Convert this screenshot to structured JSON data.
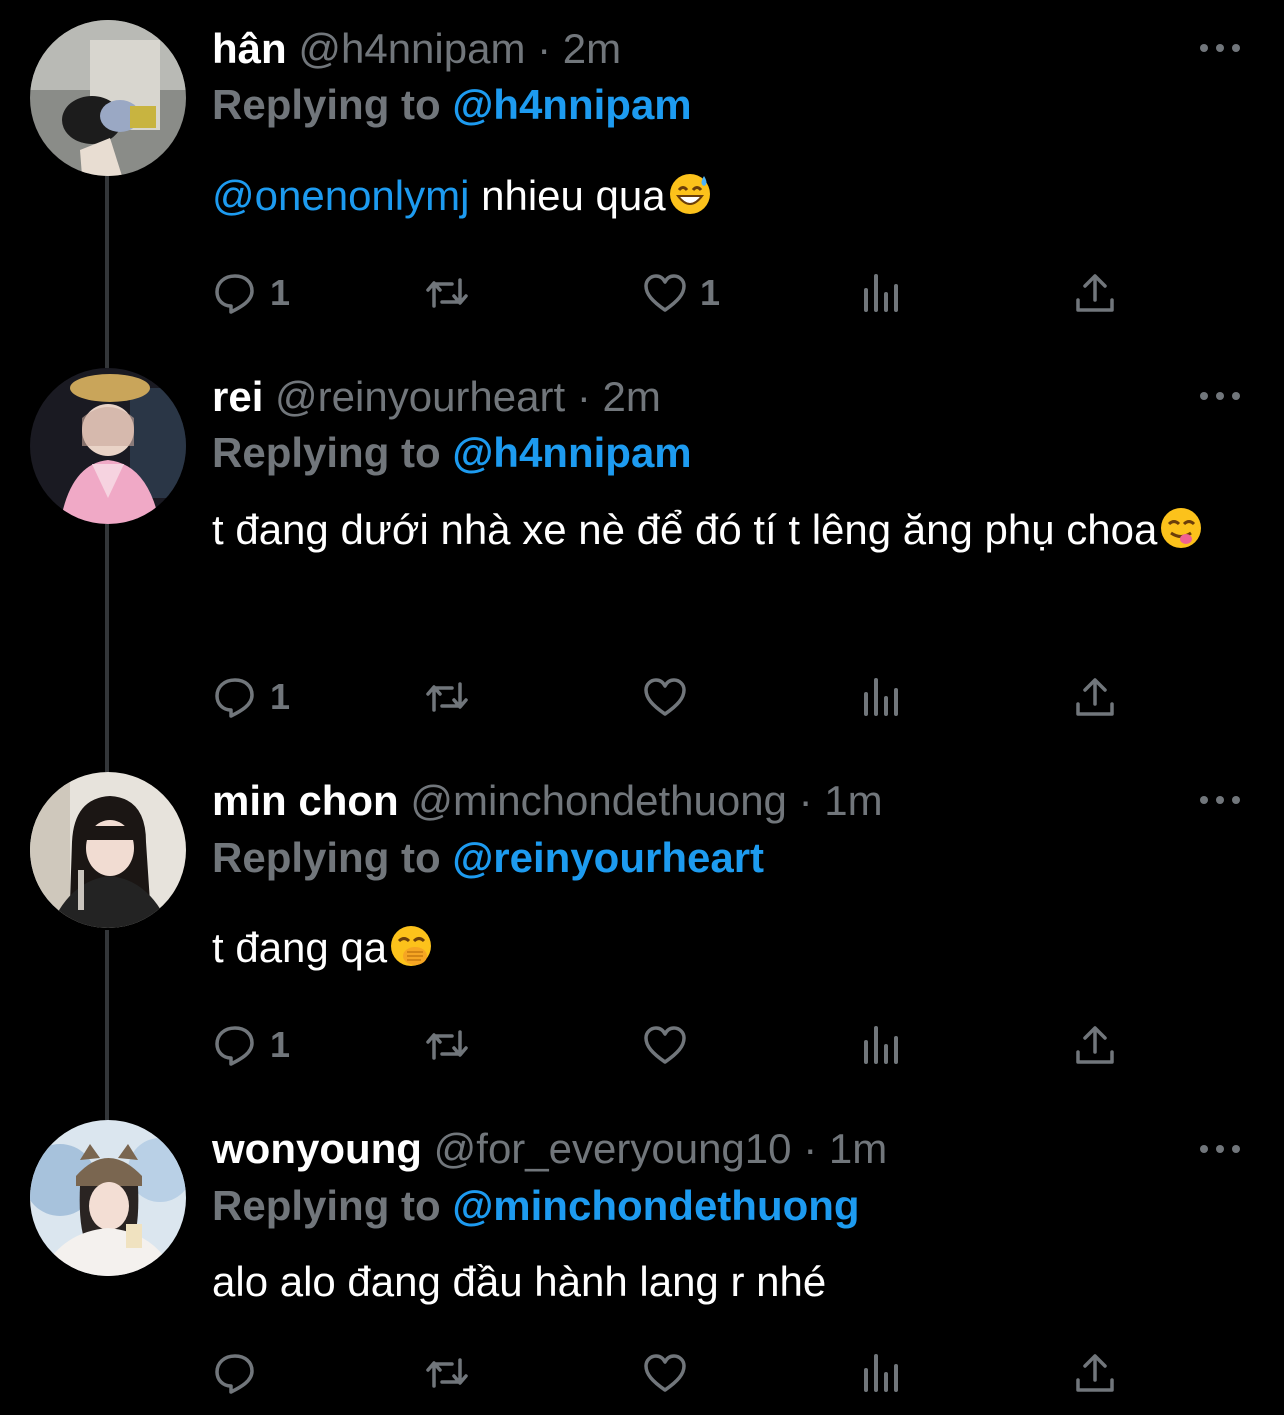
{
  "tweets": [
    {
      "name": "hân",
      "handle": "@h4nnipam",
      "separator": "·",
      "time": "2m",
      "replying_prefix": "Replying to",
      "replying_to": "@h4nnipam",
      "mention": "@onenonlymj",
      "text": " nhieu qua",
      "emoji": "grinning-sweat-emoji",
      "counts": {
        "reply": "1",
        "retweet": "",
        "like": "1"
      }
    },
    {
      "name": "rei",
      "handle": "@reinyourheart",
      "separator": "·",
      "time": "2m",
      "replying_prefix": "Replying to",
      "replying_to": "@h4nnipam",
      "mention": "",
      "text": "t đang dưới nhà xe nè để đó tí t lêng ăng phụ choa",
      "emoji": "yum-emoji",
      "counts": {
        "reply": "1",
        "retweet": "",
        "like": ""
      }
    },
    {
      "name": "min chon",
      "handle": "@minchondethuong",
      "separator": "·",
      "time": "1m",
      "replying_prefix": "Replying to",
      "replying_to": "@reinyourheart",
      "mention": "",
      "text": "t đang qa",
      "emoji": "hand-over-mouth-emoji",
      "counts": {
        "reply": "1",
        "retweet": "",
        "like": ""
      }
    },
    {
      "name": "wonyoung",
      "handle": "@for_everyoung10",
      "separator": "·",
      "time": "1m",
      "replying_prefix": "Replying to",
      "replying_to": "@minchondethuong",
      "mention": "",
      "text": "alo alo đang đầu hành lang r nhé",
      "emoji": "",
      "counts": {
        "reply": "",
        "retweet": "",
        "like": ""
      }
    }
  ],
  "icons": [
    "reply-icon",
    "retweet-icon",
    "like-icon",
    "analytics-icon",
    "share-icon",
    "more-icon"
  ],
  "colors": {
    "background": "#000000",
    "text": "#ffffff",
    "muted": "#71767b",
    "accent": "#1d9bf0",
    "thread_line": "#333639"
  }
}
